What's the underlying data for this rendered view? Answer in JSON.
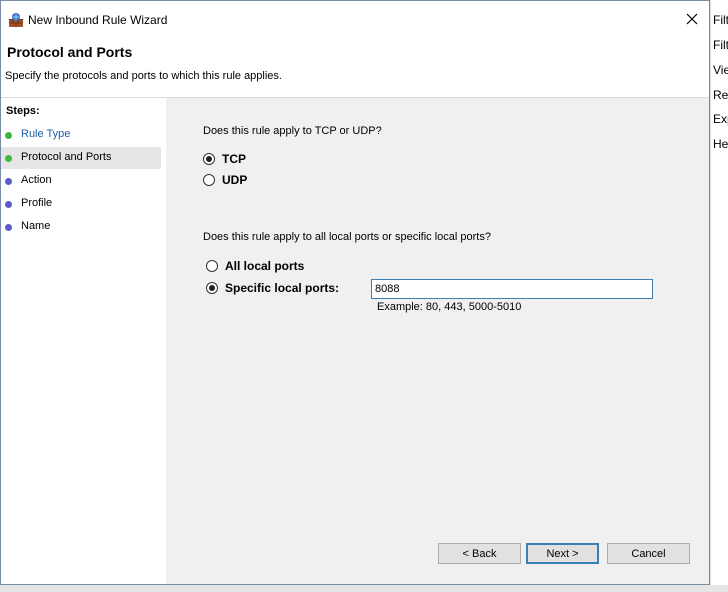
{
  "window": {
    "title": "New Inbound Rule Wizard",
    "close_icon": "close-icon"
  },
  "header": {
    "title": "Protocol and Ports",
    "subtitle": "Specify the protocols and ports to which this rule applies."
  },
  "steps": {
    "label": "Steps:",
    "items": [
      {
        "label": "Rule Type",
        "state": "completed",
        "dot_color": "#3cb83c"
      },
      {
        "label": "Protocol and Ports",
        "state": "current",
        "dot_color": "#3cb83c"
      },
      {
        "label": "Action",
        "state": "pending",
        "dot_color": "#5a5ac8"
      },
      {
        "label": "Profile",
        "state": "pending",
        "dot_color": "#5a5ac8"
      },
      {
        "label": "Name",
        "state": "pending",
        "dot_color": "#5a5ac8"
      }
    ]
  },
  "protocol": {
    "question": "Does this rule apply to TCP or UDP?",
    "options": [
      {
        "label": "TCP",
        "selected": true
      },
      {
        "label": "UDP",
        "selected": false
      }
    ]
  },
  "ports": {
    "question": "Does this rule apply to all local ports or specific local ports?",
    "options": [
      {
        "label": "All local ports",
        "selected": false
      },
      {
        "label": "Specific local ports:",
        "selected": true
      }
    ],
    "value": "8088",
    "example": "Example: 80, 443, 5000-5010"
  },
  "buttons": {
    "back": "< Back",
    "next": "Next >",
    "cancel": "Cancel"
  },
  "background_window": {
    "items": [
      "Filt",
      "Filt",
      "Vie",
      "Ref",
      "Exp",
      "He"
    ]
  }
}
